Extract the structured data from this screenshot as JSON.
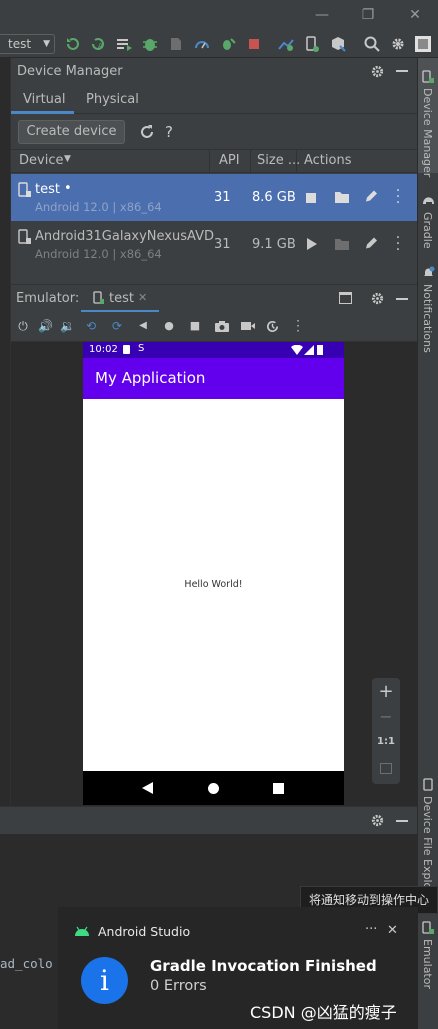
{
  "toolbar": {
    "run_config": "test"
  },
  "device_manager": {
    "title": "Device Manager",
    "tabs": [
      {
        "label": "Virtual",
        "selected": true
      },
      {
        "label": "Physical",
        "selected": false
      }
    ],
    "create_button": "Create device",
    "help_label": "?",
    "columns": {
      "device": "Device",
      "api": "API",
      "size": "Size ...",
      "actions": "Actions"
    },
    "devices": [
      {
        "name": "test",
        "running_dot": "•",
        "subtitle": "Android 12.0 | x86_64",
        "api": "31",
        "size": "8.6 GB",
        "selected": true
      },
      {
        "name": "Android31GalaxyNexusAVD",
        "subtitle": "Android 12.0 | x86_64",
        "api": "31",
        "size": "9.1 GB",
        "selected": false
      }
    ]
  },
  "emulator": {
    "label": "Emulator:",
    "tab_name": "test",
    "phone": {
      "time": "10:02",
      "app_title": "My Application",
      "body_text": "Hello World!"
    },
    "zoom": {
      "plus": "+",
      "minus": "−",
      "ratio": "1:1"
    }
  },
  "right_stripe": {
    "device_manager": "Device Manager",
    "gradle": "Gradle",
    "notifications": "Notifications",
    "device_file_explorer": "Device File Explo",
    "emulator": "Emulator"
  },
  "editor_fragment": "ad_colo",
  "tooltip": "将通知移动到操作中心",
  "notification": {
    "app": "Android Studio",
    "more": "···",
    "close": "✕",
    "title": "Gradle Invocation Finished",
    "body": "0 Errors",
    "watermark": "CSDN @凶猛的瘦子"
  },
  "colors": {
    "selected_row": "#4b6eaf",
    "app_bar": "#6200ee",
    "status_bar": "#3700b3",
    "accent_tab": "#4a88c7",
    "info_blue": "#1a73e8"
  }
}
